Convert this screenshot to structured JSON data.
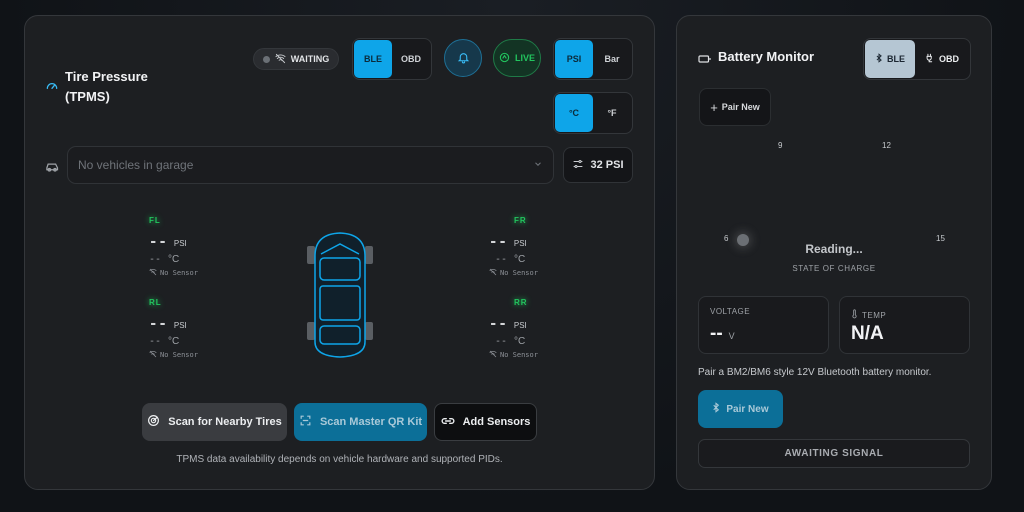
{
  "tpms": {
    "title_line1": "Tire Pressure",
    "title_line2": "(TPMS)",
    "status": "WAITING",
    "connection": [
      "BLE",
      "OBD"
    ],
    "live_label": "LIVE",
    "pressure_units": [
      "PSI",
      "Bar"
    ],
    "temp_units": [
      "°C",
      "°F"
    ],
    "vehicle_placeholder": "No vehicles in garage",
    "target_pressure": "32 PSI",
    "tires": [
      {
        "pos": "FL",
        "pressure": "--",
        "pressure_unit": "PSI",
        "temp": "--",
        "temp_unit": "°C",
        "sensor": "No Sensor"
      },
      {
        "pos": "FR",
        "pressure": "--",
        "pressure_unit": "PSI",
        "temp": "--",
        "temp_unit": "°C",
        "sensor": "No Sensor"
      },
      {
        "pos": "RL",
        "pressure": "--",
        "pressure_unit": "PSI",
        "temp": "--",
        "temp_unit": "°C",
        "sensor": "No Sensor"
      },
      {
        "pos": "RR",
        "pressure": "--",
        "pressure_unit": "PSI",
        "temp": "--",
        "temp_unit": "°C",
        "sensor": "No Sensor"
      }
    ],
    "buttons": {
      "scan_nearby": "Scan for Nearby Tires",
      "scan_qr": "Scan Master QR Kit",
      "add_sensors": "Add Sensors"
    },
    "footnote": "TPMS data availability depends on vehicle hardware and supported PIDs.",
    "colors": {
      "accent": "#0ea5e9",
      "live": "#22c55e"
    }
  },
  "battery": {
    "title": "Battery Monitor",
    "connection": [
      "BLE",
      "OBD"
    ],
    "pair_new_small": "Pair New",
    "gauge_ticks": {
      "t6": "6",
      "t9": "9",
      "t12": "12",
      "t15": "15"
    },
    "gauge_reading": "Reading...",
    "gauge_caption": "STATE OF CHARGE",
    "voltage_label": "VOLTAGE",
    "voltage_value": "--",
    "voltage_unit": "V",
    "temp_label": "TEMP",
    "temp_value": "N/A",
    "hint": "Pair a BM2/BM6 style 12V Bluetooth battery monitor.",
    "pair_new_button": "Pair New",
    "signal_status": "AWAITING SIGNAL"
  }
}
